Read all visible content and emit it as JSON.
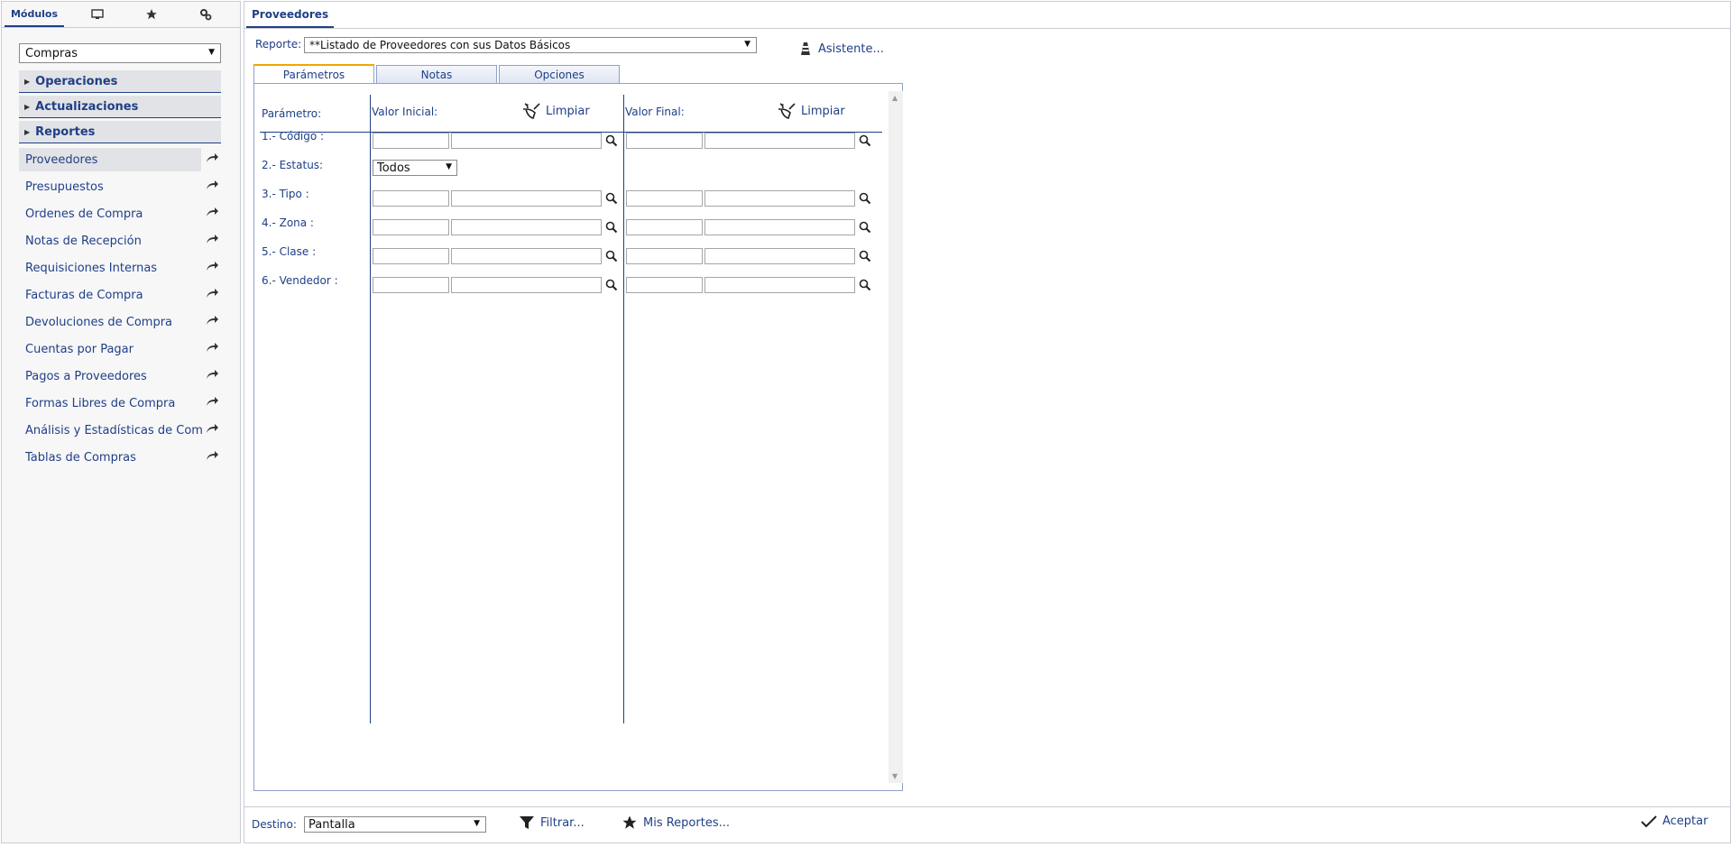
{
  "sidebar": {
    "tabs": [
      {
        "label": "Módulos",
        "icon": "list-icon"
      },
      {
        "label": "",
        "icon": "monitor-icon"
      },
      {
        "label": "",
        "icon": "star-icon"
      },
      {
        "label": "",
        "icon": "settings-icon"
      }
    ],
    "module_selected": "Compras",
    "sections": [
      "Operaciones",
      "Actualizaciones",
      "Reportes"
    ],
    "items": [
      "Proveedores",
      "Presupuestos",
      "Órdenes de Compra",
      "Notas de Recepción",
      "Requisiciones Internas",
      "Facturas de Compra",
      "Devoluciones de Compra",
      "Cuentas por Pagar",
      "Pagos a Proveedores",
      "Formas Libres de Compra",
      "Análisis y Estadísticas de Com",
      "Tablas de Compras"
    ]
  },
  "main": {
    "tab_title": "Proveedores",
    "reporte_label": "Reporte:",
    "reporte_value": "**Listado de Proveedores con sus Datos Básicos",
    "asistente_label": "Asistente...",
    "tabs": [
      "Parámetros",
      "Notas",
      "Opciones"
    ],
    "params": {
      "col_param": "Parámetro:",
      "col_inicial": "Valor Inicial:",
      "col_final": "Valor Final:",
      "limpiar": "Limpiar",
      "rows": [
        "1.- Código :",
        "2.- Estatus:",
        "3.- Tipo :",
        "4.- Zona :",
        "5.- Clase :",
        "6.- Vendedor :"
      ],
      "estatus_value": "Todos"
    },
    "footer": {
      "destino_label": "Destino:",
      "destino_value": "Pantalla",
      "filtrar_label": "Filtrar...",
      "mis_reportes_label": "Mis Reportes...",
      "aceptar_label": "Aceptar"
    }
  },
  "colors": {
    "accent": "#1f3f86",
    "active_tab_top": "#f0a800",
    "section_bg": "#e2e3e6"
  }
}
